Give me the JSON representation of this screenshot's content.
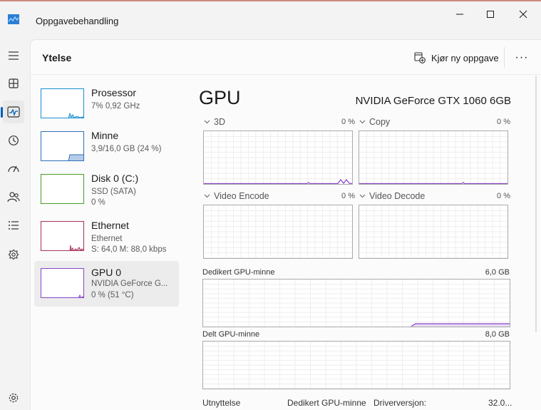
{
  "window": {
    "title": "Oppgavebehandling",
    "minimize_label": "Minimize",
    "maximize_label": "Maximize",
    "close_label": "Close"
  },
  "nav": {
    "items": [
      {
        "icon": "menu-icon"
      },
      {
        "icon": "processes-icon"
      },
      {
        "icon": "performance-icon",
        "active": true
      },
      {
        "icon": "app-history-icon"
      },
      {
        "icon": "startup-apps-icon"
      },
      {
        "icon": "users-icon"
      },
      {
        "icon": "details-icon"
      },
      {
        "icon": "services-icon"
      },
      {
        "icon": "settings-icon"
      }
    ]
  },
  "header": {
    "title": "Ytelse",
    "run_task_label": "Kjør ny oppgave",
    "more_label": "···"
  },
  "devices": [
    {
      "name": "Prosessor",
      "line1": "7% 0,92 GHz",
      "line2": "",
      "color": "#1a8fd1"
    },
    {
      "name": "Minne",
      "line1": "3,9/16,0 GB (24 %)",
      "line2": "",
      "color": "#2f6fbd",
      "usage": 0.24
    },
    {
      "name": "Disk 0 (C:)",
      "line1": "SSD (SATA)",
      "line2": "0 %",
      "color": "#4c9a2a"
    },
    {
      "name": "Ethernet",
      "line1": "Ethernet",
      "line2": "S: 64,0 M: 88,0 kbps",
      "color": "#a8325a"
    },
    {
      "name": "GPU 0",
      "line1": "NVIDIA GeForce G...",
      "line2": "0 % (51 °C)",
      "color": "#8a44c8",
      "selected": true
    }
  ],
  "gpu": {
    "title": "GPU",
    "model": "NVIDIA GeForce GTX 1060 6GB",
    "engines": [
      {
        "label": "3D",
        "pct": "0 %"
      },
      {
        "label": "Copy",
        "pct": "0 %"
      },
      {
        "label": "Video Encode",
        "pct": "0 %"
      },
      {
        "label": "Video Decode",
        "pct": "0 %"
      }
    ],
    "dedicated": {
      "label": "Dedikert GPU-minne",
      "max": "6,0 GB"
    },
    "shared": {
      "label": "Delt GPU-minne",
      "max": "8,0 GB"
    },
    "line_color": "#8a44c8"
  },
  "footer": {
    "utilization": "Utnyttelse",
    "dedicated_memory": "Dedikert GPU-minne",
    "driver_version_label": "Driverversjon:",
    "driver_version_value": "32.0..."
  }
}
